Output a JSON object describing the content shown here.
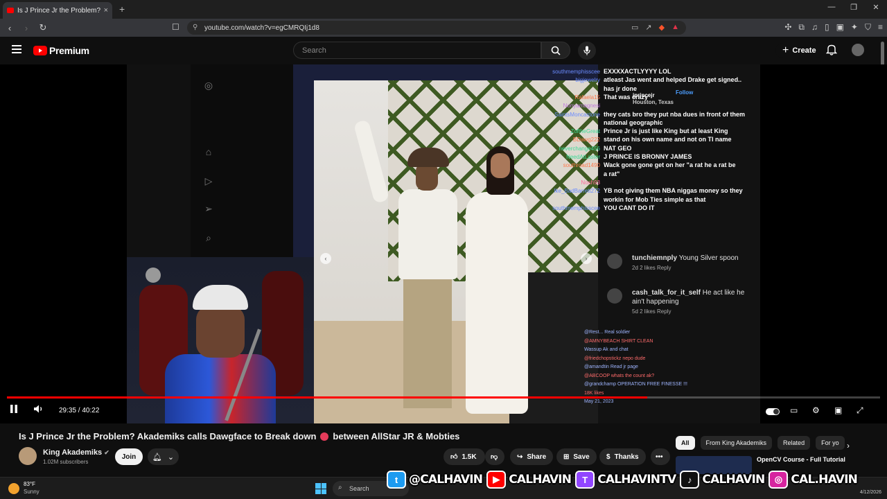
{
  "browser": {
    "tab_title": "Is J Prince Jr the Problem? Ak",
    "tab_close": "×",
    "new_tab": "+",
    "url": "youtube.com/watch?v=egCMRQIj1d8",
    "window_controls": [
      "—",
      "❐",
      "✕"
    ]
  },
  "header": {
    "logo_text": "Premium",
    "search_placeholder": "Search",
    "create_label": "Create"
  },
  "video_overlay": {
    "chat": [
      {
        "user": "southmemphisscee",
        "text": "EXXXXACTLYYYY LOL",
        "color": "#6b8cff"
      },
      {
        "user": "bigjewelry",
        "text": "atleast Jas went and helped Drake get signed..",
        "color": "#6b8cff"
      },
      {
        "user": "",
        "text": "has jr done",
        "color": ""
      },
      {
        "user": "Rafaela15",
        "text": "That was crazy",
        "color": "#ff7a4d"
      },
      {
        "user": "Nonyamagnesi",
        "text": "",
        "color": "#c07adf"
      },
      {
        "user": "SaintsMoncastone",
        "text": "they cats bro they put nba dues in front of them",
        "color": "#6b8cff"
      },
      {
        "user": "",
        "text": "national geographic",
        "color": ""
      },
      {
        "user": "ZoftheGreat",
        "text": "Prince Jr is just like King but at least King",
        "color": "#3ddc97"
      },
      {
        "user": "BDawg222",
        "text": "stand on his own name and not on TI name",
        "color": "#ff7a4d"
      },
      {
        "user": "neverchange456",
        "text": "NAT GEO",
        "color": "#3ddc97"
      },
      {
        "user": "NeedAtLaster",
        "text": "J PRINCE IS BRONNY JAMES",
        "color": "#3ddc97"
      },
      {
        "user": "southroad1490",
        "text": "Wack gone gone get on her \"a rat he a rat be",
        "color": "#ff7a4d"
      },
      {
        "user": "",
        "text": "a rat\"",
        "color": ""
      },
      {
        "user": "Nosh93",
        "text": "",
        "color": "#ff6b9b"
      },
      {
        "user": "Ike_BadBarrett272",
        "text": "YB not giving them NBA niggas money so they",
        "color": "#6b8cff"
      },
      {
        "user": "",
        "text": "workin for Mob Ties simple as that",
        "color": ""
      },
      {
        "user": "southmemphisscee",
        "text": "YOU CANT DO IT",
        "color": "#6b8cff"
      }
    ],
    "ig_post": {
      "username": "jprincejr",
      "follow": "Follow",
      "location": "Houston, Texas"
    },
    "top_comments": [
      {
        "name": "tunchiemnply",
        "text": "Young Silver spoon",
        "meta": "2d   2 likes   Reply"
      },
      {
        "name": "cash_talk_for_it_self",
        "text": "He act like he ain't happening",
        "meta": "5d   2 likes   Reply"
      }
    ],
    "mobile_chat": [
      "@Rest... Real soldier",
      "@AMNYBEACH SHIRT CLEAN",
      "Wassup Ak and chat",
      "@friedchopstickz nepo dude",
      "@amandtin Read jr page",
      "@ABCOOP whats the count ak?",
      "@grandchamp OPERATION FREE FINESSE !!!",
      "18K likes",
      "May 21, 2023"
    ]
  },
  "player": {
    "time_current": "29:35",
    "time_sep": " / ",
    "time_total": "40:22",
    "progress": 0.733
  },
  "video": {
    "title_a": "Is J Prince Jr the Problem? Akademiks calls Dawgface to Break down",
    "title_b": "between AllStar JR & Mobties",
    "channel": "King Akademiks",
    "subscribers": "1.02M subscribers",
    "join": "Join",
    "likes": "1.5K",
    "share": "Share",
    "save": "Save",
    "thanks": "Thanks",
    "more": "•••"
  },
  "chips": [
    "All",
    "From King Akademiks",
    "Related",
    "For yo"
  ],
  "recommendation": {
    "title": "OpenCV Course - Full Tutorial"
  },
  "taskbar": {
    "temp": "83°F",
    "condition": "Sunny",
    "search": "Search",
    "date": "4/12/2026"
  },
  "banner": [
    {
      "label": "@CALHAVIN",
      "color": "#1d9bf0",
      "icon": "twitter-icon",
      "glyph": "t"
    },
    {
      "label": "CALHAVIN",
      "color": "#ff0000",
      "icon": "youtube-icon",
      "glyph": "▶"
    },
    {
      "label": "CALHAVINTV",
      "color": "#9146ff",
      "icon": "twitch-icon",
      "glyph": "T"
    },
    {
      "label": "CALHAVIN",
      "color": "#111111",
      "icon": "tiktok-icon",
      "glyph": "♪"
    },
    {
      "label": "CAL.HAVIN",
      "color": "#d6249f",
      "icon": "instagram-icon",
      "glyph": "◎"
    }
  ]
}
